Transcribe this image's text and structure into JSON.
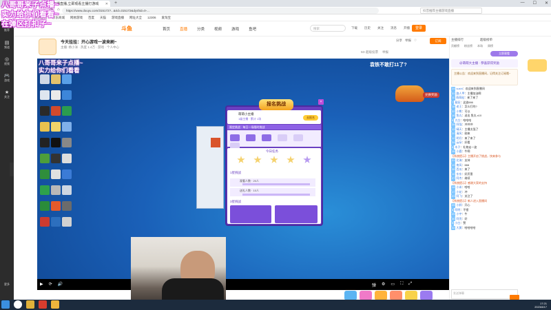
{
  "browser": {
    "tab_title": "主播直播,立即观看主播打游戏",
    "new_tab": "+",
    "window_controls": [
      "—",
      "☐",
      "✕"
    ],
    "url": "https://www.douyu.com/315172?...&rid=315172&dyshid=0-...",
    "search_placeholder": "抖音推荐主播游戏直播",
    "bookmarks": [
      "热点新闻",
      "京东商城",
      "网易游戏",
      "百度",
      "天猫",
      "游戏直播",
      "网址大全",
      "12306",
      "爱淘宝"
    ]
  },
  "appside": {
    "items": [
      {
        "icon": "♥",
        "label": "推荐"
      },
      {
        "icon": "▤",
        "label": "频道"
      },
      {
        "icon": "◎",
        "label": "视频"
      },
      {
        "icon": "🎮",
        "label": "游戏"
      },
      {
        "icon": "★",
        "label": "关注"
      }
    ],
    "bottom": "更多"
  },
  "site": {
    "logo": "斗鱼",
    "nav": [
      "首页",
      "直播",
      "分类",
      "视频",
      "游戏",
      "鱼吧"
    ],
    "active_nav": "直播",
    "search_placeholder": "搜索",
    "head_icons": [
      "下载",
      "历史",
      "关注",
      "消息",
      "开播"
    ],
    "login": "登录"
  },
  "streamer": {
    "title": "今天挂挂：开心游戏一波来刷~",
    "sub": "主播: 杨小洋 · 热度 1.4万 · 游戏 · 个人中心",
    "icons": [
      "分享",
      "举报",
      "♡"
    ],
    "follow": "订阅",
    "report_row": [
      "5D 超级投票",
      "举报"
    ]
  },
  "player": {
    "overlay_left": [
      "八哥哥来子点播~",
      "实力给你们看看"
    ],
    "overlay_right": "袁铁不敢打11了?",
    "car_label": "兑换奖励"
  },
  "popup": {
    "title": "报名挑战",
    "close": "×",
    "name": "萌萌小主播",
    "user": "1级主播 · 累计 1场",
    "button": "去报名",
    "banner": "限定挑战 · 每日一场限时挑战",
    "section1": "今日任务",
    "task1": "1星挑战",
    "bar1_text": "观看人数 · 20人",
    "bar2_text": "送礼人数 · 10人",
    "task2": "3星挑战"
  },
  "player_controls": {
    "left": [
      "▶",
      "⟳",
      "🔊"
    ],
    "right": [
      "弹",
      "⚙",
      "▭",
      "⛶",
      "⤢"
    ]
  },
  "right_panel": {
    "tabs": [
      "主播排行",
      "超级榜单"
    ],
    "sub": [
      "贡献榜",
      "粉丝榜",
      "本场",
      "周榜"
    ],
    "live_button": "立即观看",
    "card": "@萌萌大主播 · 恭喜获得奖励",
    "broadcast": "主播公告：欢迎来到直播间，记得关注订阅哦~",
    "chat": [
      {
        "lv": "24",
        "name": "sushi",
        "text": "欢迎来到直播间"
      },
      {
        "lv": "31",
        "name": "路人甲",
        "text": "主播加油啊"
      },
      {
        "lv": "11",
        "name": "萌萌哒",
        "text": "来了来了"
      },
      {
        "lv": "7",
        "name": "星辰",
        "text": "这波666"
      },
      {
        "lv": "18",
        "name": "老王",
        "text": "怎么打的?"
      },
      {
        "lv": "22",
        "name": "小熊",
        "text": "可以"
      },
      {
        "lv": "16",
        "name": "鱼丸",
        "text": "送出 鱼丸 x10"
      },
      {
        "lv": "9",
        "name": "大白",
        "text": "哈哈哈"
      },
      {
        "lv": "28",
        "name": "阿强",
        "text": "冲冲冲"
      },
      {
        "lv": "13",
        "name": "晴天",
        "text": "主播太强了"
      },
      {
        "lv": "20",
        "name": "清风",
        "text": "刚来"
      },
      {
        "lv": "12",
        "name": "明月",
        "text": "来了来了"
      },
      {
        "lv": "34",
        "name": "云朵",
        "text": "好看"
      },
      {
        "lv": "8",
        "name": "木子",
        "text": "礼物走一波"
      },
      {
        "lv": "15",
        "name": "小鹿",
        "text": "牛啊"
      },
      {
        "sys": true,
        "text": "【系统提示】主播开启了挑战，快来参与"
      },
      {
        "lv": "21",
        "name": "北海",
        "text": "支持"
      },
      {
        "lv": "19",
        "name": "南风",
        "text": "666"
      },
      {
        "lv": "26",
        "name": "西瓜",
        "text": "来了"
      },
      {
        "lv": "10",
        "name": "东东",
        "text": "好厉害"
      },
      {
        "lv": "27",
        "name": "阿杰",
        "text": "继续"
      },
      {
        "sys": true,
        "text": "【系统提示】感谢大家的支持"
      },
      {
        "lv": "14",
        "name": "小米",
        "text": "哈哈"
      },
      {
        "lv": "17",
        "name": "小花",
        "text": "冲"
      },
      {
        "lv": "23",
        "name": "阿飞",
        "text": "关注了"
      },
      {
        "sys": true,
        "text": "【系统提示】新人进入直播间"
      },
      {
        "lv": "25",
        "name": "小胖",
        "text": "开心"
      },
      {
        "lv": "6",
        "name": "阿明",
        "text": "不错"
      },
      {
        "lv": "29",
        "name": "小宇",
        "text": "牛"
      },
      {
        "lv": "30",
        "name": "阿亮",
        "text": "好"
      },
      {
        "lv": "5",
        "name": "小白",
        "text": "赞"
      },
      {
        "lv": "32",
        "name": "大黄",
        "text": "哈哈哈哈"
      }
    ],
    "input_placeholder": "发送弹幕"
  },
  "overlay_top": [
    "八哥哥来子点播~",
    "实力给你们看看~",
    "在弹区打扣子~"
  ],
  "taskbar": {
    "tray_time": "17:21",
    "tray_date": "2023/8/17"
  }
}
